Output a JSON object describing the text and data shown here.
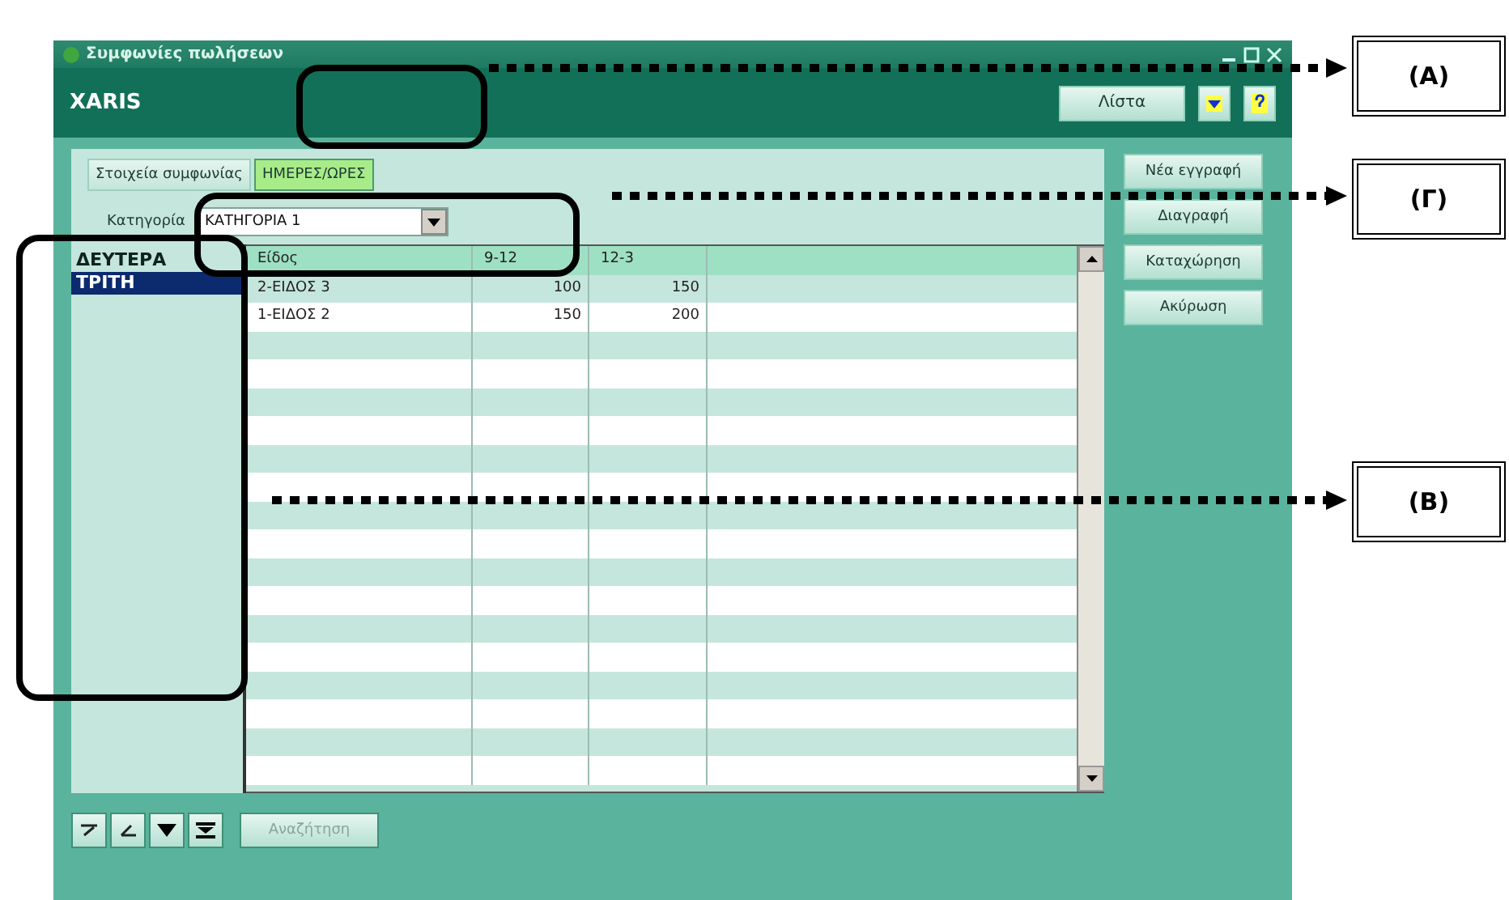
{
  "window": {
    "title": "Συμφωνίες πωλήσεων",
    "app_name": "XARIS"
  },
  "header_buttons": [
    {
      "label": "Λίστα"
    }
  ],
  "tabs": [
    {
      "label": "Στοιχεία συμφωνίας",
      "selected": false
    },
    {
      "label": "ΗΜΕΡΕΣ/ΩΡΕΣ",
      "selected": true
    }
  ],
  "category": {
    "label": "Κατηγορία",
    "value": "ΚΑΤΗΓΟΡΙΑ 1"
  },
  "days": [
    {
      "label": "ΔΕΥΤΕΡΑ",
      "selected": false
    },
    {
      "label": "ΤΡΙΤΗ",
      "selected": true
    }
  ],
  "table": {
    "columns": [
      "Είδος",
      "9-12",
      "12-3"
    ],
    "rows": [
      [
        "2-ΕΙΔΟΣ 3",
        "100",
        "150"
      ],
      [
        "1-ΕΙΔΟΣ 2",
        "150",
        "200"
      ]
    ]
  },
  "side_buttons": [
    {
      "label": "Νέα εγγραφή"
    },
    {
      "label": "Διαγραφή"
    },
    {
      "label": "Καταχώρηση"
    },
    {
      "label": "Ακύρωση"
    }
  ],
  "search_button": {
    "label": "Αναζήτηση",
    "disabled": true
  },
  "annotations": [
    {
      "label": "(A)"
    },
    {
      "label": "(Γ)"
    },
    {
      "label": "(B)"
    }
  ]
}
